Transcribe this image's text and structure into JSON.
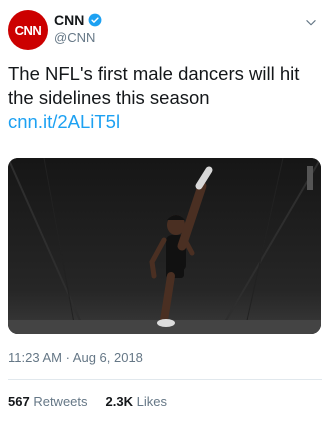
{
  "header": {
    "avatar_text": "CNN",
    "display_name": "CNN",
    "handle": "@CNN"
  },
  "tweet": {
    "text": "The NFL's first male dancers will hit the sidelines this season",
    "link": "cnn.it/2ALiT5l"
  },
  "meta": {
    "timestamp": "11:23 AM · Aug 6, 2018"
  },
  "stats": {
    "retweets_count": "567",
    "retweets_label": "Retweets",
    "likes_count": "2.3K",
    "likes_label": "Likes"
  },
  "colors": {
    "avatar_bg": "#cc0000",
    "link": "#1da1f2",
    "verified": "#1da1f2"
  }
}
